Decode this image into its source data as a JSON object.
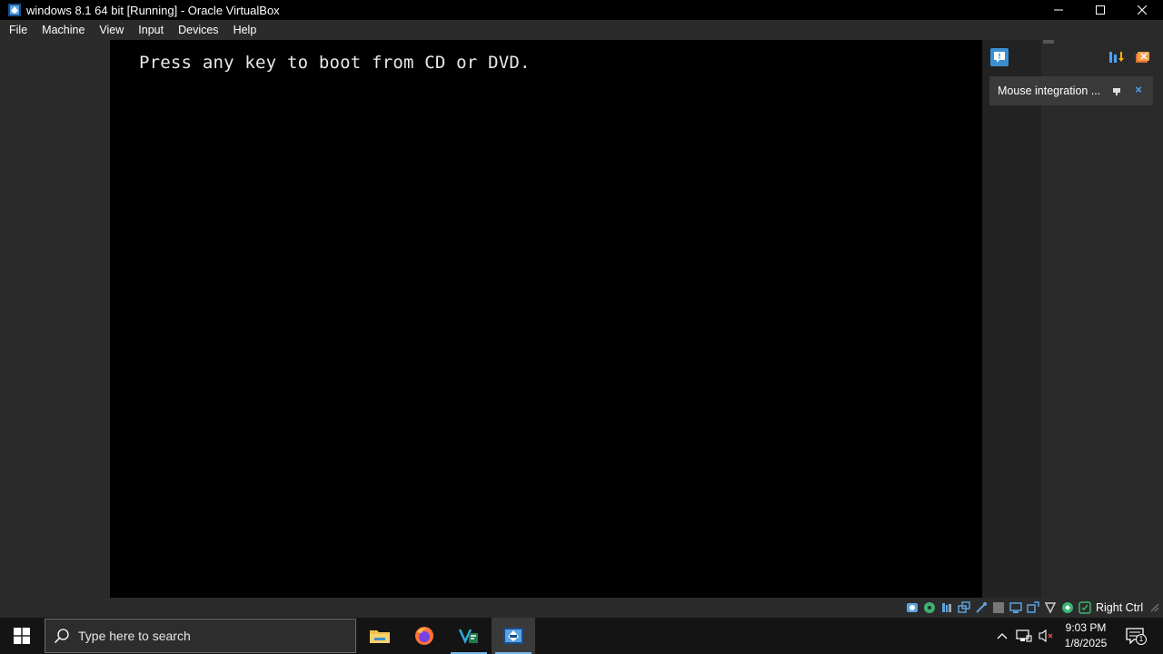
{
  "window": {
    "title": "windows 8.1 64 bit [Running] - Oracle VirtualBox",
    "app_icon": "virtualbox-icon",
    "controls": {
      "minimize": "minimize-icon",
      "maximize": "maximize-icon",
      "close": "close-icon"
    }
  },
  "menu": {
    "items": [
      "File",
      "Machine",
      "View",
      "Input",
      "Devices",
      "Help"
    ]
  },
  "vm": {
    "screen_text": "Press any key to boot from CD or DVD."
  },
  "notification": {
    "text": "Mouse integration ...",
    "close_glyph": "×"
  },
  "statusbar": {
    "icons": [
      "hard-disk-icon",
      "optical-drive-icon",
      "audio-icon",
      "network-icon",
      "usb-icon",
      "shared-folders-icon",
      "display-icon",
      "video-capture-icon",
      "cpu-icon",
      "mouse-integration-icon",
      "keyboard-icon"
    ],
    "host_key": "Right Ctrl"
  },
  "taskbar": {
    "search_placeholder": "Type here to search",
    "apps": [
      "file-explorer-icon",
      "firefox-icon",
      "vscode-icon",
      "virtualbox-icon"
    ],
    "clock": {
      "time": "9:03 PM",
      "date": "1/8/2025"
    },
    "notifications_count": "1"
  },
  "colors": {
    "titlebar": "#000000",
    "menubar": "#2b2b2b",
    "vm_screen": "#000000",
    "taskbar": "#141414",
    "accent": "#76b9ed"
  }
}
